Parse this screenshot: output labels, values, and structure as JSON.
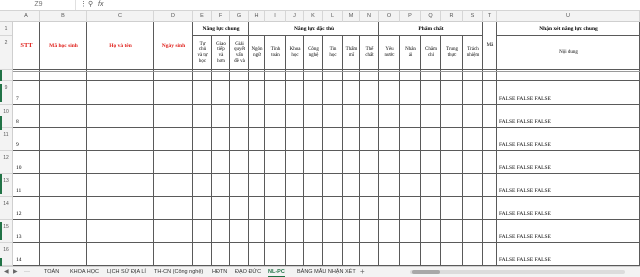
{
  "formula_bar": {
    "name_box": "Z9",
    "search_icon": "magnifier-icon",
    "fx_label": "fx"
  },
  "columns": [
    "A",
    "B",
    "C",
    "D",
    "E",
    "F",
    "G",
    "H",
    "I",
    "J",
    "K",
    "L",
    "M",
    "N",
    "O",
    "P",
    "Q",
    "R",
    "S",
    "T",
    "U"
  ],
  "rows": {
    "header_numbers": [
      "1",
      "2"
    ],
    "data_numbers": [
      "9",
      "10",
      "11",
      "12",
      "13",
      "14",
      "15",
      "16"
    ]
  },
  "header": {
    "stt": "STT",
    "ma_hoc_sinh": "Mã học sinh",
    "ho_va_ten": "Họ và tên",
    "ngay_sinh": "Ngày sinh",
    "nang_luc_chung": "Năng lực chung",
    "nang_luc_chung_items": [
      [
        "Tự",
        "chủ",
        "và tự",
        "học"
      ],
      [
        "Giao",
        "tiếp",
        "và",
        "hơn"
      ],
      [
        "Giải",
        "quyết",
        "vấn",
        "đề và"
      ]
    ],
    "nang_luc_dac_thu": "Năng lực đặc thù",
    "nang_luc_dac_thu_items": [
      [
        "Ngôn",
        "ngữ"
      ],
      [
        "Tính",
        "toán"
      ],
      [
        "Khoa",
        "học"
      ],
      [
        "Công",
        "nghệ"
      ],
      [
        "Tin",
        "học"
      ],
      [
        "Thẩm",
        "mĩ"
      ],
      [
        "Thể",
        "chất"
      ]
    ],
    "pham_chat": "Phẩm chất",
    "pham_chat_items": [
      [
        "Yêu",
        "nước"
      ],
      [
        "Nhân",
        "ái"
      ],
      [
        "Chăm",
        "chỉ"
      ],
      [
        "Trung",
        "thực"
      ],
      [
        "Trách",
        "nhiệm"
      ]
    ],
    "ma": "Mã",
    "nhan_xet": "Nhận xét năng lực chung",
    "noi_dung": "Nội dung"
  },
  "data_rows": [
    {
      "stt": "7",
      "comment": "FALSE FALSE FALSE"
    },
    {
      "stt": "8",
      "comment": "FALSE FALSE FALSE"
    },
    {
      "stt": "9",
      "comment": "FALSE FALSE FALSE"
    },
    {
      "stt": "10",
      "comment": "FALSE FALSE FALSE"
    },
    {
      "stt": "11",
      "comment": "FALSE FALSE FALSE"
    },
    {
      "stt": "12",
      "comment": "FALSE FALSE FALSE"
    },
    {
      "stt": "13",
      "comment": "FALSE FALSE FALSE"
    },
    {
      "stt": "14",
      "comment": "FALSE FALSE FALSE"
    }
  ],
  "sheet_tabs": {
    "nav_prev": "◀",
    "nav_next": "▶",
    "tabs": [
      "TOÁN",
      "KHOA HỌC",
      "LỊCH SỬ ĐỊA LÍ",
      "TH-CN (Công nghệ)",
      "HĐTN",
      "ĐẠO ĐỨC",
      "NL-PC",
      "BẢNG MẪU NHẬN XÉT"
    ],
    "active": "NL-PC",
    "more": "···",
    "add": "+"
  },
  "colors": {
    "accent": "#217346",
    "header_red": "#e0211c",
    "grid_line": "#5a5a5a"
  }
}
